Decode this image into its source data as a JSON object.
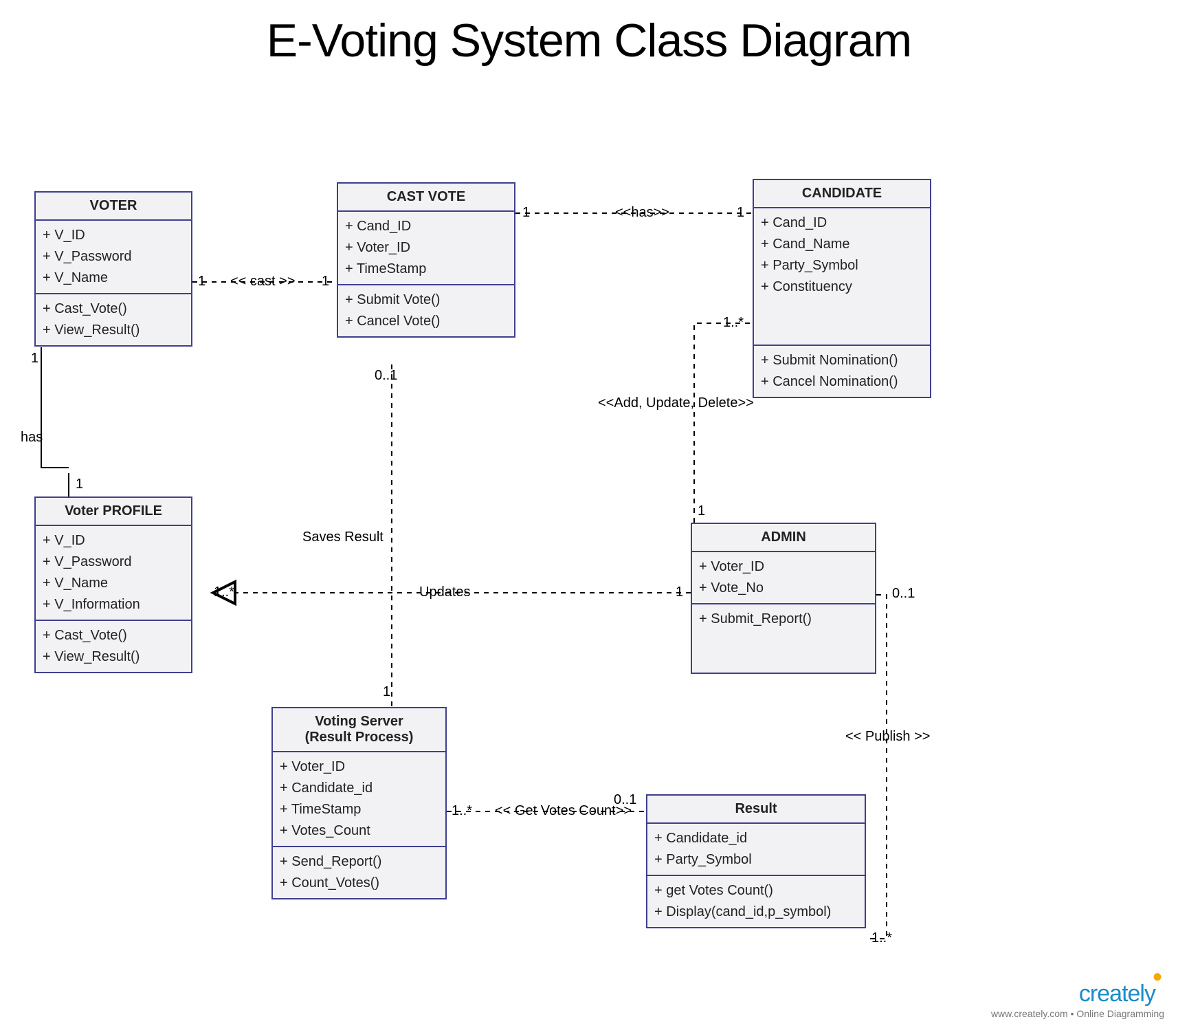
{
  "title": "E-Voting System Class Diagram",
  "classes": {
    "voter": {
      "name": "VOTER",
      "attrs": [
        "+ V_ID",
        "+ V_Password",
        "+ V_Name"
      ],
      "ops": [
        "+ Cast_Vote()",
        "+ View_Result()"
      ]
    },
    "castvote": {
      "name": "CAST VOTE",
      "attrs": [
        "+ Cand_ID",
        "+ Voter_ID",
        "+ TimeStamp"
      ],
      "ops": [
        "+ Submit Vote()",
        "+ Cancel Vote()"
      ]
    },
    "candidate": {
      "name": "CANDIDATE",
      "attrs": [
        "+ Cand_ID",
        "+ Cand_Name",
        "+ Party_Symbol",
        "+ Constituency"
      ],
      "ops": [
        "+ Submit Nomination()",
        "+ Cancel Nomination()"
      ]
    },
    "voterprofile": {
      "name": "Voter PROFILE",
      "attrs": [
        "+ V_ID",
        "+ V_Password",
        "+ V_Name",
        "+ V_Information"
      ],
      "ops": [
        "+ Cast_Vote()",
        "+ View_Result()"
      ]
    },
    "admin": {
      "name": "ADMIN",
      "attrs": [
        "+ Voter_ID",
        "+ Vote_No"
      ],
      "ops": [
        "+ Submit_Report()"
      ]
    },
    "votingserver": {
      "name_l1": "Voting Server",
      "name_l2": "(Result Process)",
      "attrs": [
        "+ Voter_ID",
        "+ Candidate_id",
        "+ TimeStamp",
        "+ Votes_Count"
      ],
      "ops": [
        "+ Send_Report()",
        "+ Count_Votes()"
      ]
    },
    "result": {
      "name": "Result",
      "attrs": [
        "+ Candidate_id",
        "+ Party_Symbol"
      ],
      "ops": [
        "+ get Votes Count()",
        "+ Display(cand_id,p_symbol)"
      ]
    }
  },
  "labels": {
    "cast": "<< cast >>",
    "has1": "<<has>>",
    "has2": "has",
    "saves": "Saves Result",
    "updates": "Updates",
    "addupdatedelete": "<<Add, Update, Delete>>",
    "getvotes": "<< Get Votes Count>>",
    "publish": "<< Publish >>",
    "m1": "1",
    "m01": "0..1",
    "m1s": "1..*"
  },
  "footer": {
    "brand": "creately",
    "tag": "www.creately.com • Online Diagramming"
  }
}
